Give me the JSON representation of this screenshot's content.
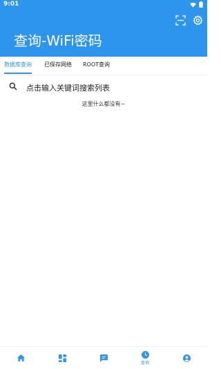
{
  "status_bar": {
    "time": "9:01"
  },
  "header": {
    "title": "查询-WiFi密码",
    "scan_icon": "scan-icon",
    "settings_icon": "gear-icon"
  },
  "tabs": [
    {
      "label": "数据库查询",
      "active": true
    },
    {
      "label": "已保存网络",
      "active": false
    },
    {
      "label": "ROOT查询",
      "active": false
    }
  ],
  "search": {
    "placeholder": "点击输入关键词搜索列表",
    "icon": "search-icon"
  },
  "empty_message": "这里什么都没有~",
  "bottom_nav": [
    {
      "icon": "home-icon",
      "label": ""
    },
    {
      "icon": "dashboard-icon",
      "label": ""
    },
    {
      "icon": "chat-icon",
      "label": ""
    },
    {
      "icon": "clock-icon",
      "label": "查询",
      "active": true
    },
    {
      "icon": "account-icon",
      "label": ""
    }
  ],
  "colors": {
    "primary": "#2e95ee",
    "background": "#ffffff",
    "text": "#222222"
  }
}
